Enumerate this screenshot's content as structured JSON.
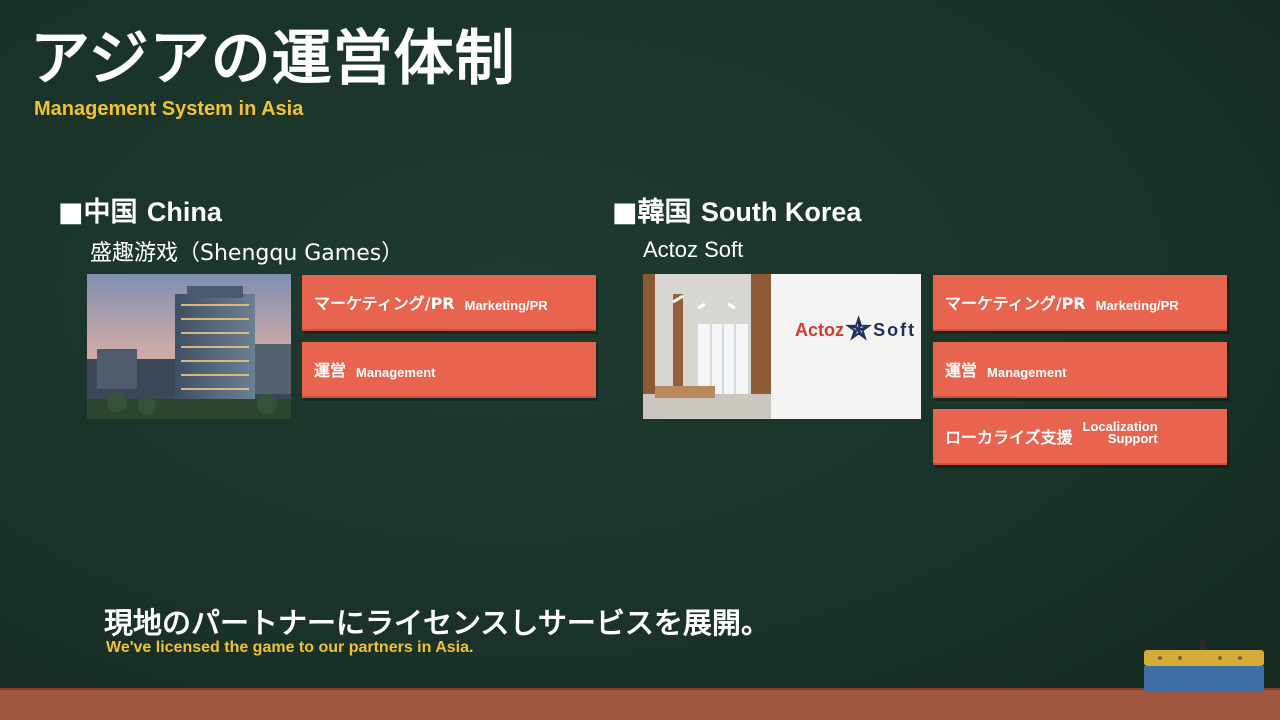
{
  "header": {
    "title": "アジアの運営体制",
    "subtitle": "Management System in Asia"
  },
  "china": {
    "heading_jp": "■中国",
    "heading_en": "China",
    "partner": "盛趣游戏（Shengqu Games）",
    "tiles": [
      {
        "jp": "マーケティング/PR",
        "en": "Marketing/PR"
      },
      {
        "jp": "運営",
        "en": "Management"
      }
    ]
  },
  "korea": {
    "heading_jp": "■韓国",
    "heading_en": "South Korea",
    "partner": "Actoz Soft",
    "logo_left": "Actoz",
    "logo_right": "Soft",
    "tiles": [
      {
        "jp": "マーケティング/PR",
        "en": "Marketing/PR"
      },
      {
        "jp": "運営",
        "en": "Management"
      },
      {
        "jp": "ローカライズ支援",
        "en_line1": "Localization",
        "en_line2": "Support"
      }
    ]
  },
  "footer": {
    "jp": "現地のパートナーにライセンスしサービスを展開。",
    "en": "We've licensed the game to our partners in Asia."
  },
  "colors": {
    "chalkboard": "#1a3329",
    "tile": "#e8644f",
    "accent_yellow": "#f2c230",
    "ledge": "#a0553f"
  }
}
